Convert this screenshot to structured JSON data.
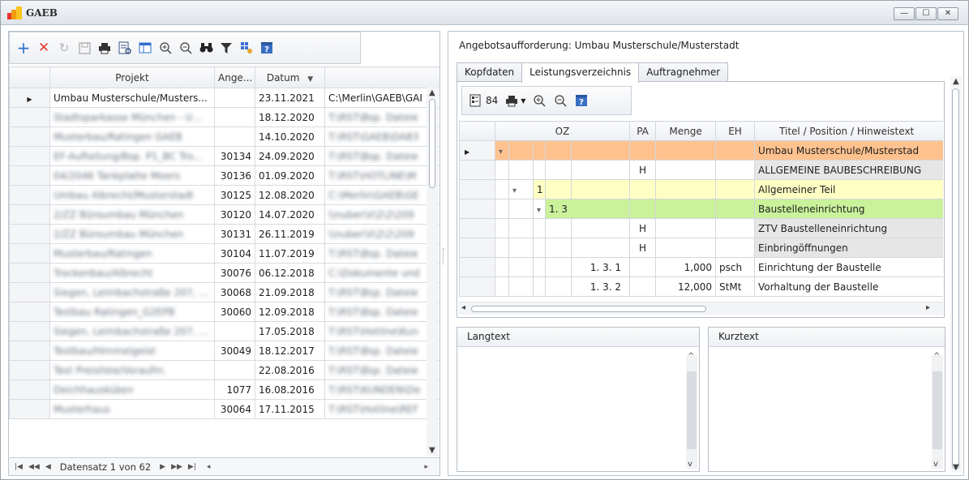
{
  "window": {
    "title": "GAEB",
    "controls": [
      "—",
      "☐",
      "✕"
    ]
  },
  "left_toolbar": {
    "icons": [
      "add-icon",
      "delete-icon",
      "refresh-icon",
      "save-icon",
      "print-icon",
      "preview-icon",
      "layout-icon",
      "zoom-in-icon",
      "zoom-out-icon",
      "binoculars-icon",
      "filter-icon",
      "grid-settings-icon",
      "help-icon"
    ]
  },
  "left_grid": {
    "columns": [
      "Projekt",
      "Ange...",
      "Datum",
      ""
    ],
    "rows": [
      {
        "projekt": "Umbau Musterschule/Musters...",
        "ange": "",
        "datum": "23.11.2021",
        "pfad": "C:\\Merlin\\GAEB\\GAI",
        "blurred": false
      },
      {
        "projekt": "Stadtsparkasse München - U...",
        "ange": "",
        "datum": "18.12.2020",
        "pfad": "T:\\RST\\Bsp. Dateie",
        "blurred": true
      },
      {
        "projekt": "Musterbau/Ratingen GAEB",
        "ange": "",
        "datum": "14.10.2020",
        "pfad": "T:\\RST\\GAEB\\DA83",
        "blurred": true
      },
      {
        "projekt": "EF-Aufteilung/Bsp. P1_BC Tro...",
        "ange": "30134",
        "datum": "24.09.2020",
        "pfad": "T:\\RST\\Bsp. Dateie",
        "blurred": true
      },
      {
        "projekt": "04/2046 Tankplatte Moers",
        "ange": "30136",
        "datum": "01.09.2020",
        "pfad": "T:\\RST\\HOTLINE\\M",
        "blurred": true
      },
      {
        "projekt": "Umbau Albrecht/Musterstadt",
        "ange": "30125",
        "datum": "12.08.2020",
        "pfad": "C:\\Merlin\\GAEB\\GE",
        "blurred": true
      },
      {
        "projekt": "2/ZZ Büroumbau München",
        "ange": "30120",
        "datum": "14.07.2020",
        "pfad": "\\\\nuber\\V\\2\\2\\209",
        "blurred": true
      },
      {
        "projekt": "2/ZZ Büroumbau München",
        "ange": "30131",
        "datum": "26.11.2019",
        "pfad": "\\\\nuber\\V\\2\\2\\209",
        "blurred": true
      },
      {
        "projekt": "Musterbau/Ratingen",
        "ange": "30104",
        "datum": "11.07.2019",
        "pfad": "T:\\RST\\Bsp. Dateie",
        "blurred": true
      },
      {
        "projekt": "Trockenbau/Albrecht",
        "ange": "30076",
        "datum": "06.12.2018",
        "pfad": "C:\\Dokumente und",
        "blurred": true
      },
      {
        "projekt": "Siegen, Leimbachstraße 207, ...",
        "ange": "30068",
        "datum": "21.09.2018",
        "pfad": "T:\\RST\\Bsp. Dateie",
        "blurred": true
      },
      {
        "projekt": "Testbau Ratingen_G2EPB",
        "ange": "30060",
        "datum": "12.09.2018",
        "pfad": "T:\\RST\\Bsp. Dateie",
        "blurred": true
      },
      {
        "projekt": "Siegen, Leimbachstraße 207, ...",
        "ange": "",
        "datum": "17.05.2018",
        "pfad": "T:\\RST\\Hotline\\Kun",
        "blurred": true
      },
      {
        "projekt": "Testbau/Himmelgeist",
        "ange": "30049",
        "datum": "18.12.2017",
        "pfad": "T:\\RST\\Bsp. Dateie",
        "blurred": true
      },
      {
        "projekt": "Test Preisliste/Voraufm.",
        "ange": "",
        "datum": "22.08.2016",
        "pfad": "T:\\RST\\Bsp. Dateie",
        "blurred": true
      },
      {
        "projekt": "Deichhausküken",
        "ange": "1077",
        "datum": "16.08.2016",
        "pfad": "T:\\RST\\KUNDEN\\De",
        "blurred": true
      },
      {
        "projekt": "Musterhaus",
        "ange": "30064",
        "datum": "17.11.2015",
        "pfad": "T:\\RST\\Hotline\\REF",
        "blurred": true
      }
    ]
  },
  "navigator": {
    "record_text": "Datensatz 1 von 62"
  },
  "right_pane": {
    "title": "Angebotsaufforderung: Umbau Musterschule/Musterstadt",
    "tabs": [
      "Kopfdaten",
      "Leistungsverzeichnis",
      "Auftragnehmer"
    ],
    "active_tab": "Leistungsverzeichnis",
    "toolbar": {
      "count": "84"
    },
    "lv_columns": [
      "OZ",
      "PA",
      "Menge",
      "EH",
      "Titel / Position / Hinweistext"
    ],
    "lv_rows": [
      {
        "level": 0,
        "oz": "",
        "pa": "",
        "menge": "",
        "eh": "",
        "text": "Umbau Musterschule/Musterstad",
        "style": "orange",
        "expander": true
      },
      {
        "level": 1,
        "oz": "",
        "pa": "H",
        "menge": "",
        "eh": "",
        "text": "ALLGEMEINE BAUBESCHREIBUNG",
        "style": "gray",
        "expander": false
      },
      {
        "level": 1,
        "oz": "1",
        "pa": "",
        "menge": "",
        "eh": "",
        "text": "Allgemeiner Teil",
        "style": "yellow",
        "expander": true
      },
      {
        "level": 2,
        "oz": "1. 3",
        "pa": "",
        "menge": "",
        "eh": "",
        "text": "Baustelleneinrichtung",
        "style": "green",
        "expander": true
      },
      {
        "level": 3,
        "oz": "",
        "pa": "H",
        "menge": "",
        "eh": "",
        "text": "ZTV Baustelleneinrichtung",
        "style": "gray",
        "expander": false
      },
      {
        "level": 3,
        "oz": "",
        "pa": "H",
        "menge": "",
        "eh": "",
        "text": "Einbringöffnungen",
        "style": "gray",
        "expander": false
      },
      {
        "level": 3,
        "oz": "1. 3.  1",
        "pa": "",
        "menge": "1,000",
        "eh": "psch",
        "text": "Einrichtung der Baustelle",
        "style": "white",
        "expander": false
      },
      {
        "level": 3,
        "oz": "1. 3.  2",
        "pa": "",
        "menge": "12,000",
        "eh": "StMt",
        "text": "Vorhaltung der Baustelle",
        "style": "white",
        "expander": false
      }
    ],
    "langtext_label": "Langtext",
    "kurztext_label": "Kurztext"
  },
  "colors": {
    "orange": "#ffc28f",
    "yellow": "#ffffc4",
    "green": "#c9f29b",
    "gray": "#e6e6e6"
  }
}
